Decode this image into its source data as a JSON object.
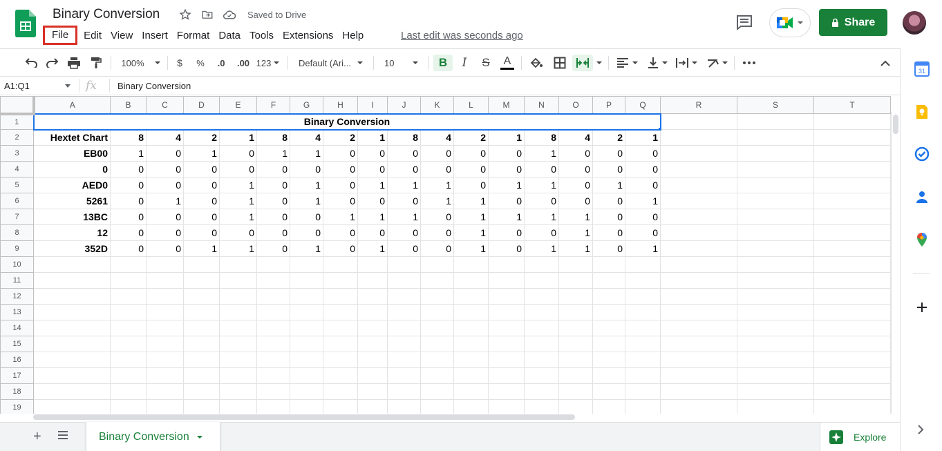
{
  "app": {
    "title": "Binary Conversion",
    "saved_status": "Saved to Drive",
    "last_edit": "Last edit was seconds ago",
    "share_label": "Share",
    "explore_label": "Explore"
  },
  "menu": [
    "File",
    "Edit",
    "View",
    "Insert",
    "Format",
    "Data",
    "Tools",
    "Extensions",
    "Help"
  ],
  "toolbar": {
    "zoom": "100%",
    "currency": "$",
    "percent": "%",
    "dec_decrease": ".0",
    "dec_increase": ".00",
    "more_formats": "123",
    "font": "Default (Ari...",
    "font_size": "10"
  },
  "formula_bar": {
    "name_box": "A1:Q1",
    "fx": "fx",
    "content": "Binary Conversion"
  },
  "columns": [
    "A",
    "B",
    "C",
    "D",
    "E",
    "F",
    "G",
    "H",
    "I",
    "J",
    "K",
    "L",
    "M",
    "N",
    "O",
    "P",
    "Q",
    "R",
    "S",
    "T"
  ],
  "sheet": {
    "title_cell": "Binary Conversion",
    "header_row": [
      "Hextet Chart",
      "8",
      "4",
      "2",
      "1",
      "8",
      "4",
      "2",
      "1",
      "8",
      "4",
      "2",
      "1",
      "8",
      "4",
      "2",
      "1"
    ],
    "rows": [
      [
        "EB00",
        "1",
        "0",
        "1",
        "0",
        "1",
        "1",
        "0",
        "0",
        "0",
        "0",
        "0",
        "0",
        "1",
        "0",
        "0",
        "0"
      ],
      [
        "0",
        "0",
        "0",
        "0",
        "0",
        "0",
        "0",
        "0",
        "0",
        "0",
        "0",
        "0",
        "0",
        "0",
        "0",
        "0",
        "0"
      ],
      [
        "AED0",
        "0",
        "0",
        "0",
        "1",
        "0",
        "1",
        "0",
        "1",
        "1",
        "1",
        "0",
        "1",
        "1",
        "0",
        "1",
        "0"
      ],
      [
        "5261",
        "0",
        "1",
        "0",
        "1",
        "0",
        "1",
        "0",
        "0",
        "0",
        "1",
        "1",
        "0",
        "0",
        "0",
        "0",
        "1"
      ],
      [
        "13BC",
        "0",
        "0",
        "0",
        "1",
        "0",
        "0",
        "1",
        "1",
        "1",
        "0",
        "1",
        "1",
        "1",
        "1",
        "0",
        "0"
      ],
      [
        "12",
        "0",
        "0",
        "0",
        "0",
        "0",
        "0",
        "0",
        "0",
        "0",
        "0",
        "1",
        "0",
        "0",
        "1",
        "0",
        "0"
      ],
      [
        "352D",
        "0",
        "0",
        "1",
        "1",
        "0",
        "1",
        "0",
        "1",
        "0",
        "0",
        "1",
        "0",
        "1",
        "1",
        "0",
        "1"
      ]
    ],
    "row_numbers": [
      "1",
      "2",
      "3",
      "4",
      "5",
      "6",
      "7",
      "8",
      "9",
      "10",
      "11",
      "12",
      "13",
      "14",
      "15",
      "16",
      "17",
      "18",
      "19"
    ]
  },
  "tabs": [
    {
      "label": "Binary Conversion"
    }
  ],
  "colors": {
    "brand_green": "#188038",
    "selection_blue": "#1a73e8",
    "highlight_red": "#d93025"
  }
}
